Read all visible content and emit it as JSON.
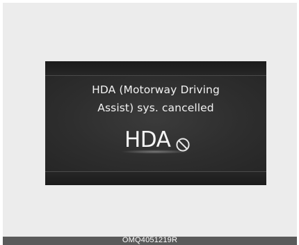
{
  "display": {
    "message_line1": "HDA (Motorway Driving",
    "message_line2": "Assist) sys. cancelled",
    "indicator_label": "HDA",
    "indicator_icon": "cancel-icon"
  },
  "caption": {
    "code": "OMQ4051219R"
  },
  "colors": {
    "background": "#ececec",
    "screen": "#2a2a2a",
    "text": "#f2f2f2",
    "caption_bar": "#5a5a5a"
  }
}
